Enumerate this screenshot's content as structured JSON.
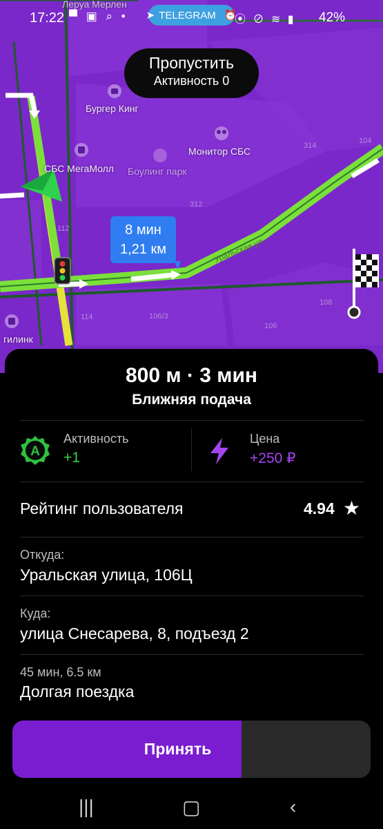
{
  "status_bar": {
    "time": "17:22",
    "telegram_label": "TELEGRAM",
    "battery": "42%"
  },
  "map": {
    "labels": {
      "top_street": "Леруа Мерлен",
      "burger_king": "Бургер Кинг",
      "mall": "СБС МегаМолл",
      "bowling": "Боулинг парк",
      "monitor": "Монитор СБС",
      "bottom_left": "гилинк"
    },
    "house_numbers": [
      "314",
      "312",
      "114",
      "106/3",
      "106",
      "108",
      "104",
      "112"
    ],
    "street_name": "Уральская ул.",
    "eta_time": "8 мин",
    "eta_distance": "1,21 км"
  },
  "skip": {
    "title": "Пропустить",
    "subtitle": "Активность 0"
  },
  "order": {
    "distance_time": "800 м · 3 мин",
    "pickup_type": "Ближняя подача",
    "activity_label": "Активность",
    "activity_value": "+1",
    "activity_badge": "А",
    "price_label": "Цена",
    "price_value": "+250 ₽",
    "rating_label": "Рейтинг пользователя",
    "rating_value": "4.94",
    "from_label": "Откуда:",
    "from_value": "Уральская улица, 106Ц",
    "to_label": "Куда:",
    "to_value": "улица Снесарева, 8, подъезд 2",
    "trip_meta": "45 мин, 6.5 км",
    "trip_type": "Долгая поездка"
  },
  "accept": {
    "label": "Принять",
    "progress": 0.64
  },
  "colors": {
    "accent": "#7a1dd0",
    "activity_green": "#3bd14a",
    "price_purple": "#a445f0",
    "map_bg": "#7a28c9",
    "route": "#7be03a"
  },
  "icons": [
    "telegram-icon",
    "location-icon",
    "wifi-icon",
    "signal-icon",
    "burger-poi-icon",
    "shop-poi-icon",
    "bowling-poi-icon",
    "cinema-poi-icon",
    "traffic-light-icon",
    "car-arrow-icon",
    "finish-flag-icon",
    "bolt-icon",
    "star-icon",
    "recent-apps-icon",
    "home-icon",
    "back-icon"
  ]
}
